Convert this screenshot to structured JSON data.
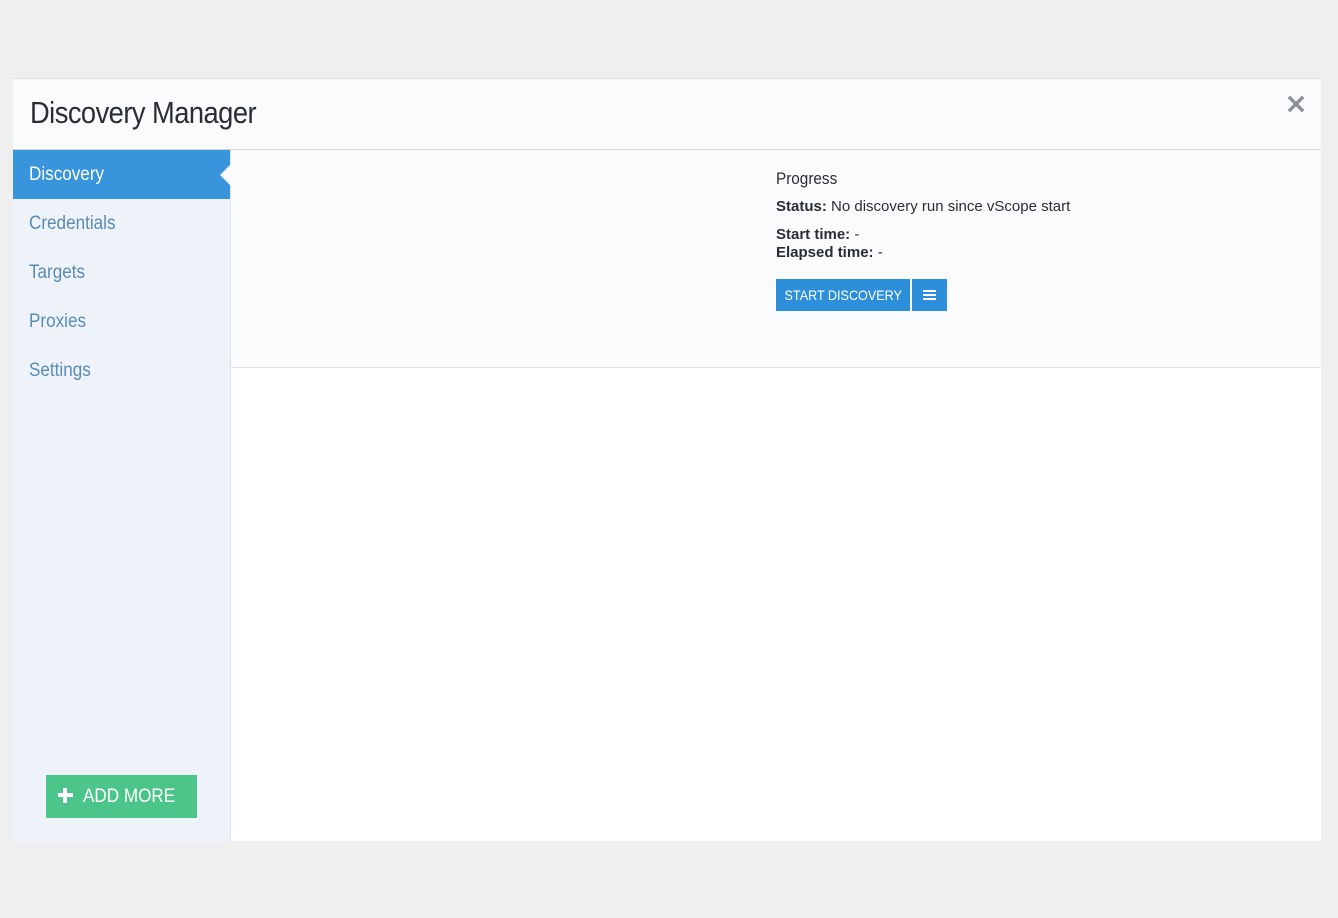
{
  "dialog": {
    "title": "Discovery Manager",
    "close_icon": "close-icon"
  },
  "sidebar": {
    "items": [
      {
        "label": "Discovery",
        "active": true
      },
      {
        "label": "Credentials",
        "active": false
      },
      {
        "label": "Targets",
        "active": false
      },
      {
        "label": "Proxies",
        "active": false
      },
      {
        "label": "Settings",
        "active": false
      }
    ],
    "add_more": {
      "label": "ADD MORE",
      "icon": "plus-icon"
    }
  },
  "progress": {
    "title": "Progress",
    "status_label": "Status:",
    "status_value": "No discovery run since vScope start",
    "start_time_label": "Start time:",
    "start_time_value": "-",
    "elapsed_time_label": "Elapsed time:",
    "elapsed_time_value": "-",
    "start_button_label": "START DISCOVERY",
    "menu_icon": "menu-icon"
  },
  "colors": {
    "accent_blue": "#3894db",
    "button_blue": "#2d8fda",
    "add_green": "#4cc58a",
    "nav_text": "#5a8bb4",
    "sidebar_bg": "#eef3f9",
    "page_bg": "#efeff0"
  }
}
